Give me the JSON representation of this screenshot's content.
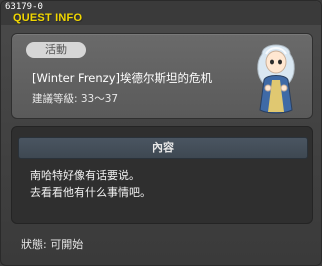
{
  "header": {
    "quest_id": "63179-0",
    "title": "QUEST INFO"
  },
  "quest": {
    "tag": "活動",
    "name": "[Winter Frenzy]埃德尔斯坦的危机",
    "level_label": "建議等級: 33～37"
  },
  "content": {
    "section_title": "內容",
    "lines": [
      "南哈特好像有话要说。",
      "去看看他有什么事情吧。"
    ]
  },
  "status": {
    "text": "狀態: 可開始"
  },
  "colors": {
    "title_yellow": "#f1d700",
    "panel_gray": "#5f5f5f",
    "content_panel": "#2f2f2f",
    "content_bar": "#44505a"
  },
  "icons": {
    "npc_portrait": "npc-portrait-icon"
  }
}
